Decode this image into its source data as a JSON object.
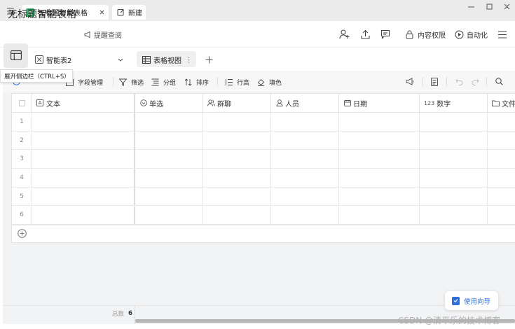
{
  "tabs": [
    {
      "label": "无标题智能表格",
      "active": true
    },
    {
      "label": "新建",
      "active": false
    }
  ],
  "header": {
    "title": "无标题智能表格",
    "reminder_label": "提醒查阅",
    "permission_label": "内容权限",
    "automation_label": "自动化"
  },
  "sheet": {
    "name": "智能表2",
    "view_name": "表格视图"
  },
  "toolbar": {
    "fields_label": "字段管理",
    "filter_label": "筛选",
    "group_label": "分组",
    "sort_label": "排序",
    "row_height_label": "行高",
    "fill_label": "填色"
  },
  "tooltip": "展开侧边栏（CTRL+S）",
  "columns": [
    {
      "label": "文本",
      "icon": "text-field-icon",
      "prefix": "A"
    },
    {
      "label": "单选",
      "icon": "single-select-icon",
      "prefix": ""
    },
    {
      "label": "群聊",
      "icon": "group-chat-icon",
      "prefix": ""
    },
    {
      "label": "人员",
      "icon": "person-icon",
      "prefix": ""
    },
    {
      "label": "日期",
      "icon": "calendar-icon",
      "prefix": ""
    },
    {
      "label": "数字",
      "icon": "number-icon",
      "prefix": "123"
    },
    {
      "label": "文件",
      "icon": "folder-icon",
      "prefix": ""
    }
  ],
  "rows": [
    "1",
    "2",
    "3",
    "4",
    "5",
    "6"
  ],
  "footer": {
    "total_label": "总数",
    "total_value": "6"
  },
  "guide_label": "使用向导",
  "watermark": "CSDN @清平乐的技术博客",
  "colors": {
    "accent": "#2f6fdb",
    "tab_bar": "#ebebeb",
    "content_bg": "#f2f3f5",
    "border": "#e3e3e3"
  }
}
